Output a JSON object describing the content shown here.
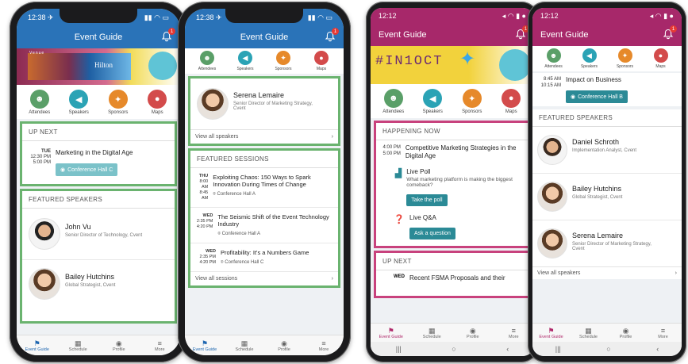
{
  "colors": {
    "ios_blue": "#2a73b8",
    "android_pink": "#a7286a",
    "green_border": "#6ab36f",
    "teal": "#2b8a96"
  },
  "phone1": {
    "time": "12:38 ✈",
    "title": "Event Guide",
    "badge": "1",
    "banner": {
      "logo": "Hilton",
      "venue": "Venue"
    },
    "icons": [
      {
        "label": "Attendees"
      },
      {
        "label": "Speakers"
      },
      {
        "label": "Sponsors"
      },
      {
        "label": "Maps"
      }
    ],
    "up_next": {
      "heading": "UP NEXT",
      "day": "TUE",
      "start": "12:30 PM",
      "end": "5:00 PM",
      "title": "Marketing in the Digital Age",
      "location": "Conference Hall C"
    },
    "featured": {
      "heading": "FEATURED SPEAKERS",
      "speakers": [
        {
          "name": "John Vu",
          "role": "Senior Director of Technology, Cvent"
        },
        {
          "name": "Bailey Hutchins",
          "role": "Global Strategist, Cvent"
        }
      ]
    },
    "tabs": [
      {
        "label": "Event Guide"
      },
      {
        "label": "Schedule"
      },
      {
        "label": "Profile"
      },
      {
        "label": "More"
      }
    ]
  },
  "phone2": {
    "time": "12:38 ✈",
    "title": "Event Guide",
    "badge": "1",
    "icons": [
      {
        "label": "Attendees"
      },
      {
        "label": "Speakers"
      },
      {
        "label": "Sponsors"
      },
      {
        "label": "Maps"
      }
    ],
    "speaker": {
      "name": "Serena Lemaire",
      "role": "Senior Director of Marketing Strategy, Cvent"
    },
    "view_all_speakers": "View all speakers",
    "featured_sessions": {
      "heading": "FEATURED SESSIONS",
      "sessions": [
        {
          "day": "THU",
          "start": "8:00 AM",
          "end": "8:45 AM",
          "title": "Exploiting Chaos: 150 Ways to Spark Innovation During Times of Change",
          "location": "Conference Hall A"
        },
        {
          "day": "WED",
          "start": "2:35 PM",
          "end": "4:20 PM",
          "title": "The Seismic Shift of the Event Technology Industry",
          "location": "Conference Hall A"
        },
        {
          "day": "WED",
          "start": "2:35 PM",
          "end": "4:20 PM",
          "title": "Profitability: It's a Numbers Game",
          "location": "Conference Hall C"
        }
      ]
    },
    "view_all_sessions": "View all sessions",
    "tabs": [
      {
        "label": "Event Guide"
      },
      {
        "label": "Schedule"
      },
      {
        "label": "Profile"
      },
      {
        "label": "More"
      }
    ]
  },
  "phone3": {
    "time": "12:12",
    "title": "Event Guide",
    "badge": "1",
    "banner_text": "#IN1OCT",
    "icons": [
      {
        "label": "Attendees"
      },
      {
        "label": "Speakers"
      },
      {
        "label": "Sponsors"
      },
      {
        "label": "Maps"
      }
    ],
    "happening": {
      "heading": "HAPPENING NOW",
      "start": "4:00 PM",
      "end": "5:00 PM",
      "title": "Competitive Marketing Strategies in the Digital Age",
      "poll_title": "Live Poll",
      "poll_question": "What marketing platform is making the biggest comeback?",
      "poll_button": "Take the poll",
      "qa_title": "Live Q&A",
      "qa_button": "Ask a question"
    },
    "up_next": {
      "heading": "UP NEXT",
      "day": "WED",
      "title": "Recent FSMA Proposals and their"
    },
    "tabs": [
      {
        "label": "Event Guide"
      },
      {
        "label": "Schedule"
      },
      {
        "label": "Profile"
      },
      {
        "label": "More"
      }
    ]
  },
  "phone4": {
    "time": "12:12",
    "title": "Event Guide",
    "badge": "1",
    "icons": [
      {
        "label": "Attendees"
      },
      {
        "label": "Speakers"
      },
      {
        "label": "Sponsors"
      },
      {
        "label": "Maps"
      }
    ],
    "session": {
      "start": "8:45 AM",
      "end": "10:15 AM",
      "title": "Impact on Business",
      "location": "Conference Hall B"
    },
    "featured": {
      "heading": "FEATURED SPEAKERS",
      "speakers": [
        {
          "name": "Daniel Schroth",
          "role": "Implementation Analyst, Cvent"
        },
        {
          "name": "Bailey Hutchins",
          "role": "Global Strategist, Cvent"
        },
        {
          "name": "Serena Lemaire",
          "role": "Senior Director of Marketing Strategy, Cvent"
        }
      ]
    },
    "view_all_speakers": "View all speakers",
    "tabs": [
      {
        "label": "Event Guide"
      },
      {
        "label": "Schedule"
      },
      {
        "label": "Profile"
      },
      {
        "label": "More"
      }
    ]
  }
}
